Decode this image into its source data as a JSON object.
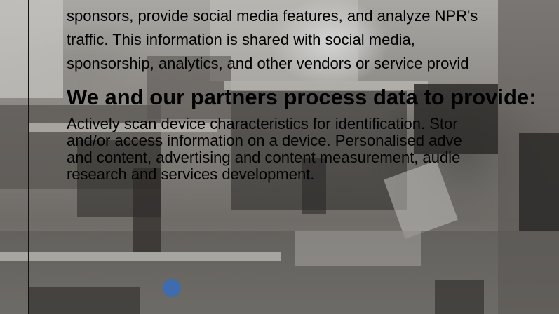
{
  "consent": {
    "intro_lines": [
      "sponsors, provide social media features, and analyze NPR's",
      "traffic. This information is shared with social media,",
      "sponsorship, analytics, and other vendors or service provid"
    ],
    "heading": "We and our partners process data to provide:",
    "purposes_lines": [
      "Actively scan device characteristics for identification. Stor",
      "and/or access information on a device. Personalised adve",
      "and content, advertising and content measurement, audie",
      "research and services development."
    ]
  },
  "background": {
    "description_icon": "photo-background"
  }
}
